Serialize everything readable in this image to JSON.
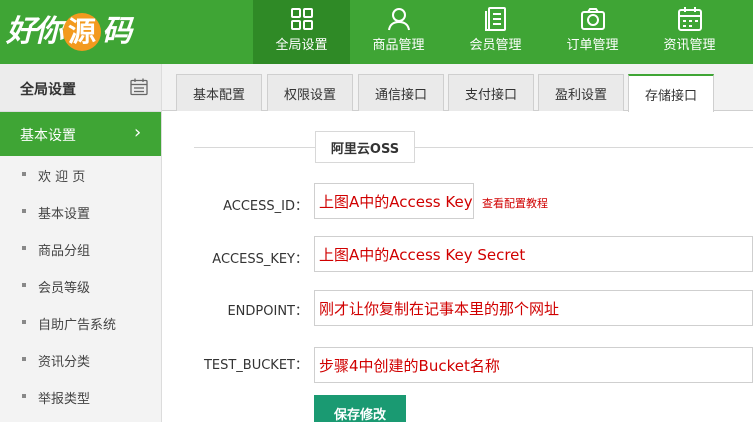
{
  "logo": {
    "chars": [
      "好",
      "你",
      "源",
      "码"
    ]
  },
  "nav": [
    {
      "label": "全局设置",
      "icon": "grid-icon",
      "active": true
    },
    {
      "label": "商品管理",
      "icon": "user-icon"
    },
    {
      "label": "会员管理",
      "icon": "list-icon"
    },
    {
      "label": "订单管理",
      "icon": "camera-icon"
    },
    {
      "label": "资讯管理",
      "icon": "calendar-icon"
    }
  ],
  "sidebar": {
    "header": "全局设置",
    "active": "基本设置",
    "items": [
      "欢 迎 页",
      "基本设置",
      "商品分组",
      "会员等级",
      "自助广告系统",
      "资讯分类",
      "举报类型"
    ]
  },
  "tabs": [
    {
      "label": "基本配置"
    },
    {
      "label": "权限设置"
    },
    {
      "label": "通信接口"
    },
    {
      "label": "支付接口"
    },
    {
      "label": "盈利设置"
    },
    {
      "label": "存储接口",
      "active": true
    }
  ],
  "form": {
    "section_title": "阿里云OSS",
    "access_id": {
      "label": "ACCESS_ID：",
      "value": "上图A中的Access Key ID",
      "hint": "查看配置教程"
    },
    "access_key": {
      "label": "ACCESS_KEY：",
      "value": "上图A中的Access Key Secret"
    },
    "endpoint": {
      "label": "ENDPOINT：",
      "value": "刚才让你复制在记事本里的那个网址"
    },
    "test_bucket": {
      "label": "TEST_BUCKET：",
      "value": "步骤4中创建的Bucket名称"
    },
    "save_label": "保存修改"
  },
  "colors": {
    "primary": "#3fa535",
    "primary_dark": "#2f8a26",
    "accent_red": "#d00000",
    "button": "#1a9a72"
  }
}
